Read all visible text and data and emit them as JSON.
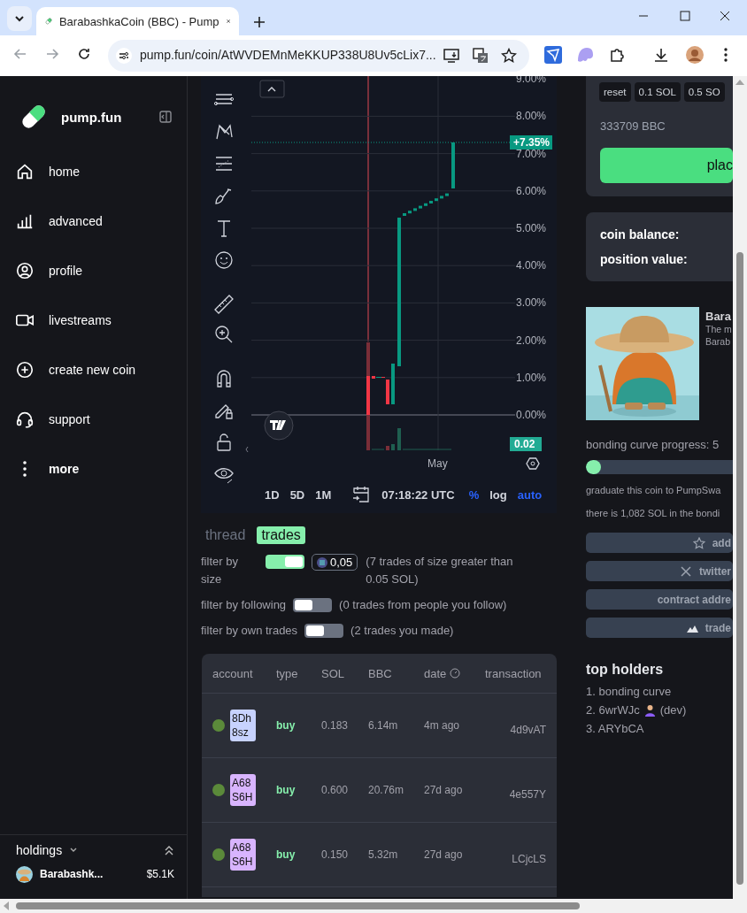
{
  "browser": {
    "tab_title": "BarabashkaCoin (BBC) - Pump",
    "url": "pump.fun/coin/AtWVDEMnMeKKUP338U8Uv5cLix7..."
  },
  "sidebar": {
    "logo": "pump.fun",
    "items": [
      {
        "label": "home"
      },
      {
        "label": "advanced"
      },
      {
        "label": "profile"
      },
      {
        "label": "livestreams"
      },
      {
        "label": "create new coin"
      },
      {
        "label": "support"
      },
      {
        "label": "more"
      }
    ],
    "holdings": {
      "title": "holdings",
      "items": [
        {
          "name": "Barabashk...",
          "value": "$5.1K"
        }
      ]
    }
  },
  "chart": {
    "y_labels": [
      "9.00%",
      "8.00%",
      "7.00%",
      "6.00%",
      "5.00%",
      "4.00%",
      "3.00%",
      "2.00%",
      "1.00%",
      "0.00%"
    ],
    "x_label": "May",
    "last_change": "+7.35%",
    "volume_label": "0.02",
    "intervals": [
      "1D",
      "5D",
      "1M"
    ],
    "time": "07:18:22 UTC",
    "scale_options": [
      {
        "label": "%",
        "selected": true
      },
      {
        "label": "log",
        "selected": false
      },
      {
        "label": "auto",
        "selected": true
      }
    ]
  },
  "tabs": [
    {
      "label": "thread",
      "selected": false
    },
    {
      "label": "trades",
      "selected": true
    }
  ],
  "filters": [
    {
      "label": "filter by size",
      "on": true,
      "amount": "0,05",
      "note": "(7 trades of size greater than 0.05 SOL)"
    },
    {
      "label": "filter by following",
      "on": false,
      "note": "(0 trades from people you follow)"
    },
    {
      "label": "filter by own trades",
      "on": false,
      "note": "(2 trades you made)"
    }
  ],
  "trades_table": {
    "columns": [
      "account",
      "type",
      "SOL",
      "BBC",
      "date",
      "transaction"
    ],
    "rows": [
      {
        "account": "8Dh8sz",
        "color": "#c7d2fe",
        "type": "buy",
        "sol": "0.183",
        "amount": "6.14m",
        "date": "4m ago",
        "transaction": "4d9vAT"
      },
      {
        "account": "A68S6H",
        "color": "#d8b4fe",
        "type": "buy",
        "sol": "0.600",
        "amount": "20.76m",
        "date": "27d ago",
        "transaction": "4e557Y"
      },
      {
        "account": "A68S6H",
        "color": "#d8b4fe",
        "type": "buy",
        "sol": "0.150",
        "amount": "5.32m",
        "date": "27d ago",
        "transaction": "LCjcLS"
      }
    ]
  },
  "trade_panel": {
    "quick_amounts": [
      "reset",
      "0.1 SOL",
      "0.5 SO"
    ],
    "estimate": "333709 BBC",
    "action": "plac"
  },
  "position": {
    "labels": [
      "coin balance:",
      "position value:"
    ]
  },
  "coin": {
    "name": "Bara",
    "description_lines": [
      "The m",
      "Barab"
    ]
  },
  "bonding": {
    "label": "bonding curve progress: 5",
    "level": 0.1,
    "lines": [
      "graduate this coin to PumpSwa",
      "there is 1,082 SOL in the bondi"
    ]
  },
  "links": [
    {
      "label": "add"
    },
    {
      "label": "twitter"
    },
    {
      "label": "contract addre"
    },
    {
      "label": "trade"
    }
  ],
  "top_holders": {
    "title": "top holders",
    "items": [
      {
        "text": "1. bonding curve"
      },
      {
        "text": "2. 6wrWJc",
        "tag": "(dev)"
      },
      {
        "text": "3. ARYbCA"
      }
    ]
  }
}
